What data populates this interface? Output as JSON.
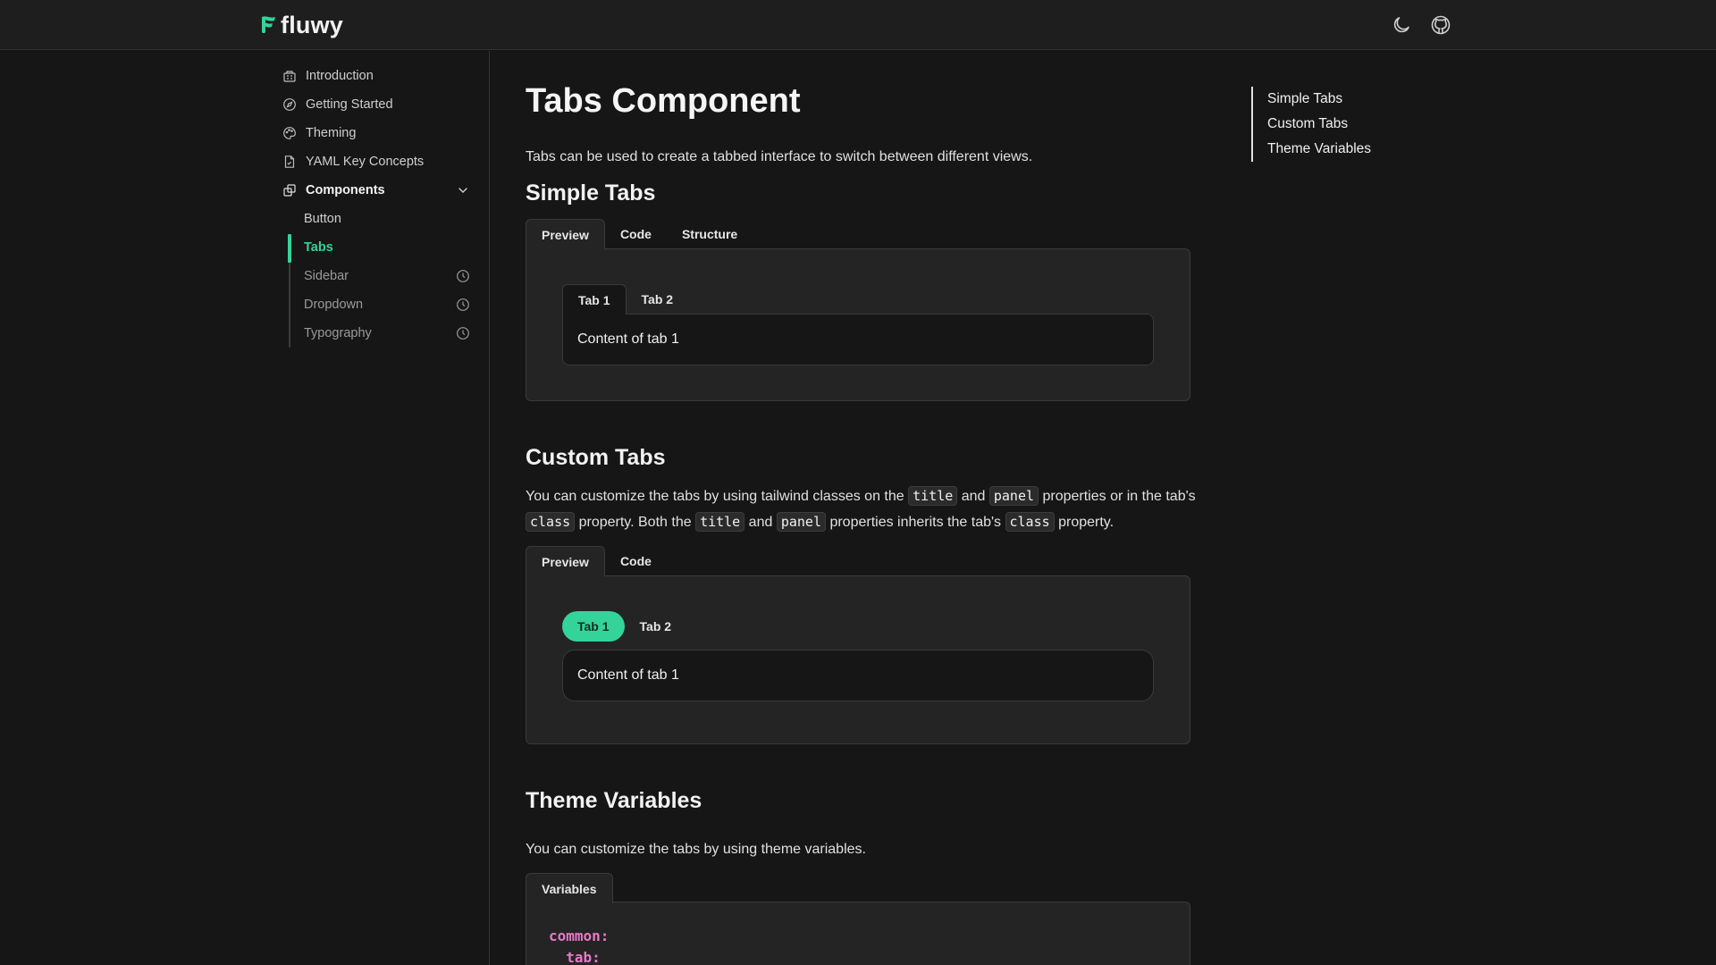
{
  "header": {
    "logo_text": "fluwy",
    "theme_toggle_icon": "moon-icon",
    "github_icon": "github-icon"
  },
  "sidebar": {
    "items": [
      {
        "label": "Introduction",
        "icon": "building-icon"
      },
      {
        "label": "Getting Started",
        "icon": "compass-icon"
      },
      {
        "label": "Theming",
        "icon": "palette-icon"
      },
      {
        "label": "YAML Key Concepts",
        "icon": "document-icon"
      },
      {
        "label": "Components",
        "icon": "components-icon",
        "expanded": true
      }
    ],
    "components": [
      {
        "label": "Button",
        "status": "available"
      },
      {
        "label": "Tabs",
        "status": "active"
      },
      {
        "label": "Sidebar",
        "status": "coming-soon",
        "icon": "clock-icon"
      },
      {
        "label": "Dropdown",
        "status": "coming-soon",
        "icon": "clock-icon"
      },
      {
        "label": "Typography",
        "status": "coming-soon",
        "icon": "clock-icon"
      }
    ]
  },
  "main": {
    "title": "Tabs Component",
    "intro": "Tabs can be used to create a tabbed interface to switch between different views.",
    "simple": {
      "heading": "Simple Tabs",
      "doc_tabs": [
        "Preview",
        "Code",
        "Structure"
      ],
      "demo_tabs": [
        "Tab 1",
        "Tab 2"
      ],
      "panel_text": "Content of tab 1"
    },
    "custom": {
      "heading": "Custom Tabs",
      "desc": {
        "p1": "You can customize the tabs by using tailwind classes on the",
        "code_title": "title",
        "and1": "and",
        "code_panel": "panel",
        "p2": "properties or in the",
        "p3": "tab's",
        "code_class": "class",
        "p4": "property. Both the",
        "and2": "and",
        "p5": "properties inherits the tab's",
        "p6": "property."
      },
      "doc_tabs": [
        "Preview",
        "Code"
      ],
      "demo_tabs": [
        "Tab 1",
        "Tab 2"
      ],
      "panel_text": "Content of tab 1"
    },
    "theme": {
      "heading": "Theme Variables",
      "desc": "You can customize the tabs by using theme variables.",
      "doc_tabs": [
        "Variables"
      ],
      "code_lines": [
        "common:",
        "  tab:"
      ]
    }
  },
  "toc": {
    "items": [
      "Simple Tabs",
      "Custom Tabs",
      "Theme Variables"
    ]
  },
  "colors": {
    "accent": "#34d399",
    "background": "#161616",
    "surface": "#242424",
    "code_keyword": "#e879c9"
  }
}
